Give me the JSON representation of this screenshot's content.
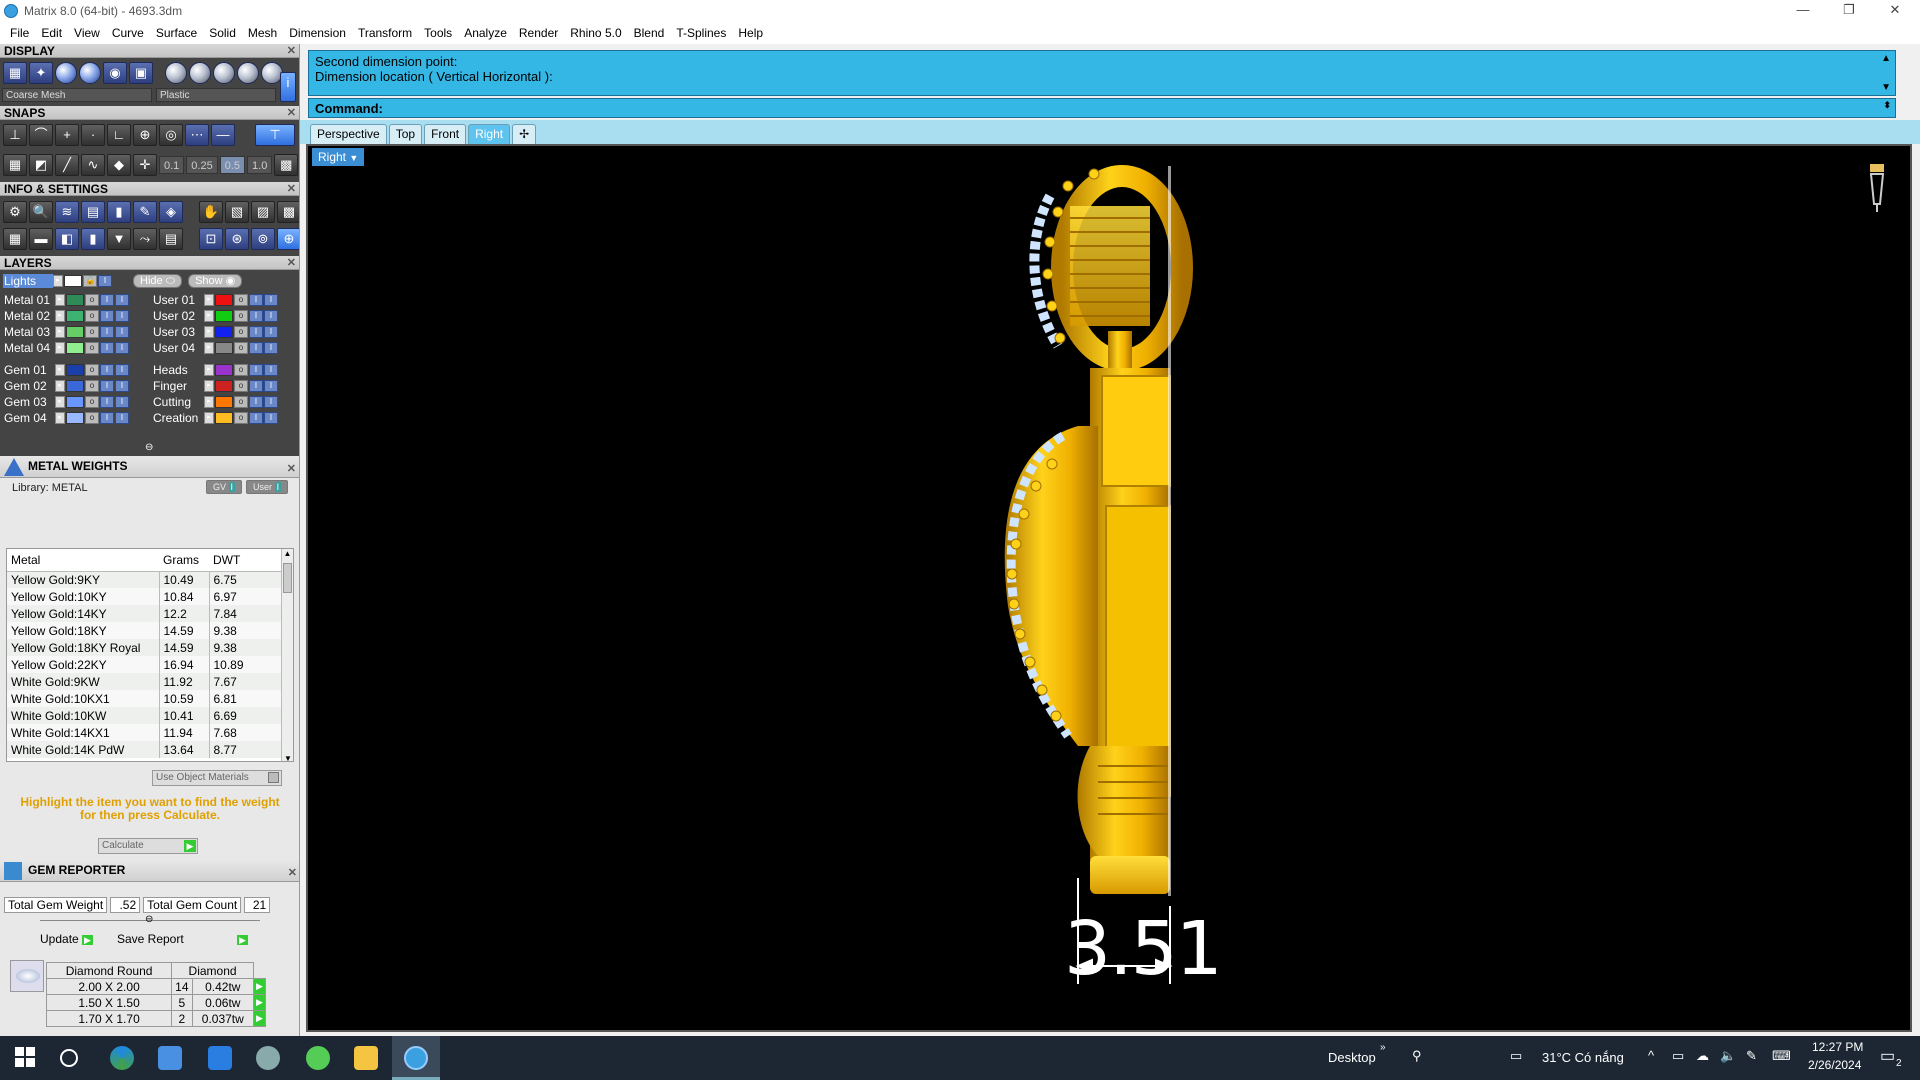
{
  "window": {
    "title": "Matrix 8.0 (64-bit) - 4693.3dm",
    "minimize": "—",
    "restore": "❐",
    "close": "✕"
  },
  "menu": [
    "File",
    "Edit",
    "View",
    "Curve",
    "Surface",
    "Solid",
    "Mesh",
    "Dimension",
    "Transform",
    "Tools",
    "Analyze",
    "Render",
    "Rhino 5.0",
    "Blend",
    "T-Splines",
    "Help"
  ],
  "display": {
    "title": "DISPLAY",
    "mesh_select": "Coarse Mesh",
    "material_select": "Plastic"
  },
  "snaps": {
    "title": "SNAPS",
    "values": [
      "0.1",
      "0.25",
      "0.5",
      "1.0"
    ]
  },
  "info": {
    "title": "INFO & SETTINGS"
  },
  "layers": {
    "title": "LAYERS",
    "lights": "Lights",
    "hide": "Hide",
    "show": "Show",
    "left_rows": [
      {
        "name": "Metal 01",
        "color": "#2e8b57"
      },
      {
        "name": "Metal 02",
        "color": "#3cb371"
      },
      {
        "name": "Metal 03",
        "color": "#66cc66"
      },
      {
        "name": "Metal 04",
        "color": "#90ee90"
      },
      {
        "name": "Gem 01",
        "color": "#1a3fa8"
      },
      {
        "name": "Gem 02",
        "color": "#3a68d8"
      },
      {
        "name": "Gem 03",
        "color": "#6a96ff"
      },
      {
        "name": "Gem 04",
        "color": "#9ab8ff"
      }
    ],
    "right_rows": [
      {
        "name": "User 01",
        "color": "#ee1111"
      },
      {
        "name": "User 02",
        "color": "#11cc11"
      },
      {
        "name": "User 03",
        "color": "#1122ee"
      },
      {
        "name": "User 04",
        "color": "#888888"
      },
      {
        "name": "Heads",
        "color": "#9933cc"
      },
      {
        "name": "Finger",
        "color": "#cc2222"
      },
      {
        "name": "Cutting",
        "color": "#ff7700"
      },
      {
        "name": "Creation",
        "color": "#ffbb22"
      }
    ]
  },
  "metal_weights": {
    "title": "METAL WEIGHTS",
    "library": "Library: METAL",
    "gv": "GV",
    "user": "User",
    "columns": [
      "Metal",
      "Grams",
      "DWT"
    ],
    "rows": [
      [
        "Yellow Gold:9KY",
        "10.49",
        "6.75"
      ],
      [
        "Yellow Gold:10KY",
        "10.84",
        "6.97"
      ],
      [
        "Yellow Gold:14KY",
        "12.2",
        "7.84"
      ],
      [
        "Yellow Gold:18KY",
        "14.59",
        "9.38"
      ],
      [
        "Yellow Gold:18KY Royal",
        "14.59",
        "9.38"
      ],
      [
        "Yellow Gold:22KY",
        "16.94",
        "10.89"
      ],
      [
        "White Gold:9KW",
        "11.92",
        "7.67"
      ],
      [
        "White Gold:10KX1",
        "10.59",
        "6.81"
      ],
      [
        "White Gold:10KW",
        "10.41",
        "6.69"
      ],
      [
        "White Gold:14KX1",
        "11.94",
        "7.68"
      ],
      [
        "White Gold:14K PdW",
        "13.64",
        "8.77"
      ]
    ],
    "use_object_materials": "Use Object Materials",
    "hint": "Highlight the item you want to find the weight for then press Calculate.",
    "calculate": "Calculate"
  },
  "gem_reporter": {
    "title": "GEM REPORTER",
    "total_weight_label": "Total Gem Weight",
    "total_weight_value": ".52",
    "total_count_label": "Total Gem Count",
    "total_count_value": "21",
    "update": "Update",
    "save_report": "Save Report",
    "shape": "Diamond Round",
    "material": "Diamond",
    "rows": [
      [
        "2.00 X 2.00",
        "14",
        "0.42tw"
      ],
      [
        "1.50 X 1.50",
        "5",
        "0.06tw"
      ],
      [
        "1.70 X 1.70",
        "2",
        "0.037tw"
      ]
    ]
  },
  "command": {
    "line1": "Second dimension point:",
    "line2": "Dimension location ( Vertical  Horizontal ):",
    "prompt": "Command:"
  },
  "viewports": {
    "tabs": [
      "Perspective",
      "Top",
      "Front",
      "Right"
    ],
    "active": "Right",
    "current_label": "Right",
    "dimension": "3.51"
  },
  "taskbar": {
    "desktop": "Desktop",
    "weather": "31°C  Có nắng",
    "time": "12:27 PM",
    "date": "2/26/2024",
    "notif": "2"
  },
  "colors": {
    "command_bg": "#35b7e6",
    "gold": "#f2b800",
    "viewport_bg": "#000000",
    "taskbar_bg": "#1c2733"
  }
}
